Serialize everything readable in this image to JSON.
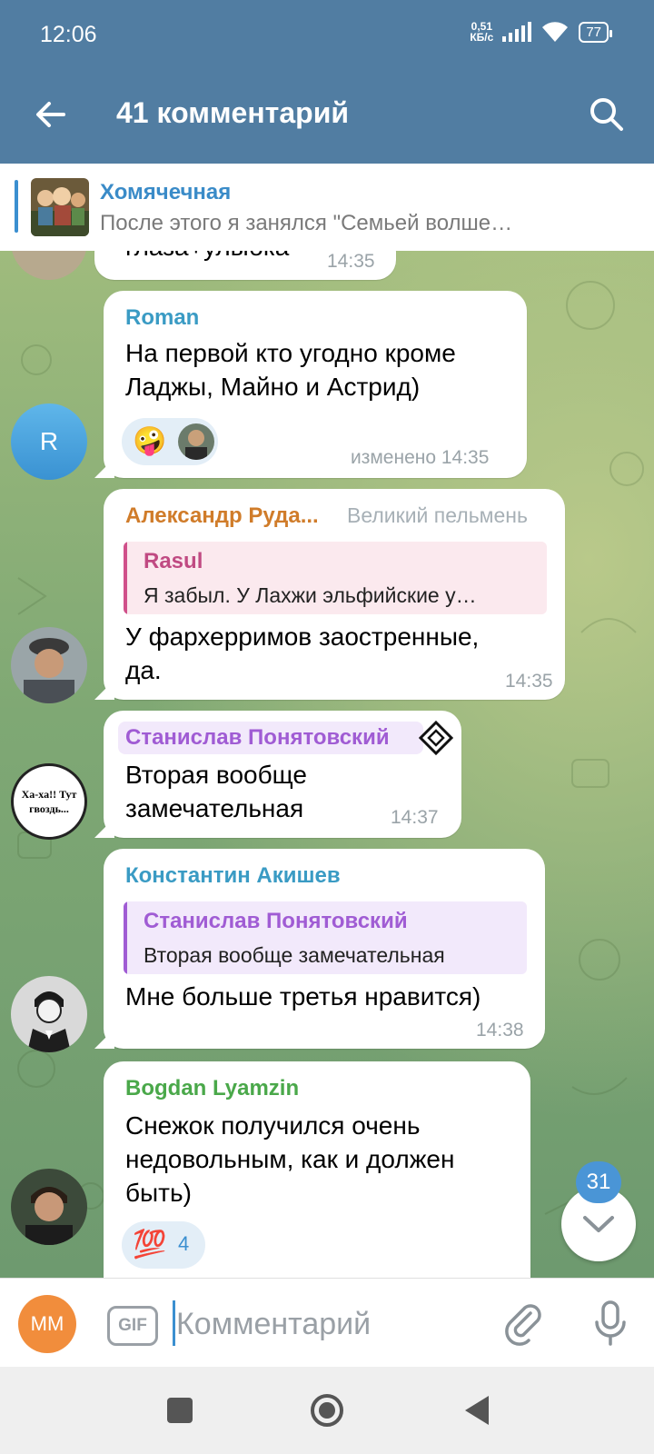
{
  "status_bar": {
    "time": "12:06",
    "net_speed_value": "0,51",
    "net_speed_unit": "КБ/с",
    "battery": "77"
  },
  "header": {
    "title": "41 комментарий",
    "back_icon": "arrow-left-icon",
    "search_icon": "search-icon"
  },
  "pinned": {
    "title": "Хомячечная",
    "text": "После этого я занялся \"Семьей волше…"
  },
  "messages": [
    {
      "text": "глаза+улыбка",
      "time": "14:35"
    },
    {
      "sender": "Roman",
      "sender_color": "#3a9bc4",
      "avatar_letter": "R",
      "lines": [
        "На первой кто угодно кроме",
        "Ладжы, Майно и Астрид)"
      ],
      "reactions": [
        "🤪"
      ],
      "time": "изменено 14:35"
    },
    {
      "sender": "Александр Руда...",
      "sender_color": "#d07c2a",
      "admin_title": "Великий пельмень",
      "reply": {
        "name": "Rasul",
        "text": "Я забыл. У Лахжи эльфийские у…"
      },
      "lines": [
        "У фархерримов заостренные,",
        "да."
      ],
      "time": "14:35"
    },
    {
      "sender": "Станислав Понятовский",
      "sender_color": "#a05cd4",
      "avatar_text_1": "Ха-ха!! Тут",
      "avatar_text_2": "гвоздь...",
      "lines": [
        "Вторая вообще",
        "замечательная"
      ],
      "time": "14:37"
    },
    {
      "sender": "Константин Акишев",
      "sender_color": "#3a9bc4",
      "reply": {
        "name": "Станислав Понятовский",
        "text": "Вторая вообще замечательная"
      },
      "lines": [
        "Мне больше третья нравится)"
      ],
      "time": "14:38"
    },
    {
      "sender": "Bogdan Lyamzin",
      "sender_color": "#4aa84a",
      "lines": [
        "Снежок получился очень",
        "недовольным, как и должен",
        "быть)"
      ],
      "reaction_emoji": "💯",
      "reaction_count": "4"
    }
  ],
  "scroll_down": {
    "unread": "31"
  },
  "input": {
    "avatar_initials": "MM",
    "gif_label": "GIF",
    "placeholder": "Комментарий"
  },
  "colors": {
    "header": "#517da2",
    "accent": "#3b8fd0"
  }
}
